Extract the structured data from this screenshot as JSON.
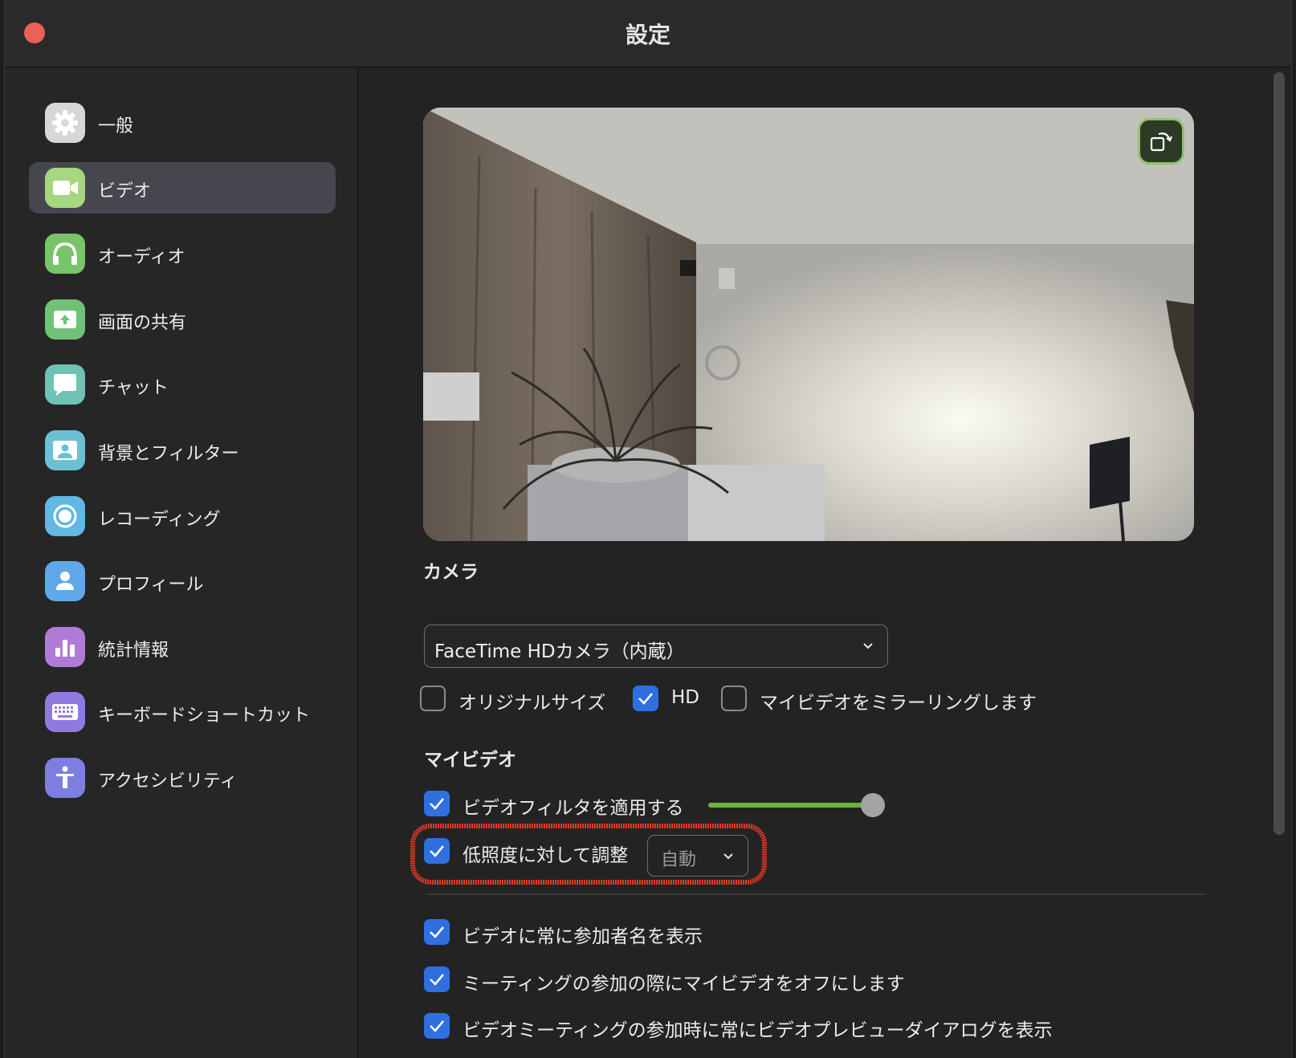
{
  "window": {
    "title": "設定"
  },
  "sidebar": {
    "items": [
      {
        "label": "一般",
        "icon": "gear-icon",
        "color": "#d7d7d7",
        "active": false
      },
      {
        "label": "ビデオ",
        "icon": "video-camera-icon",
        "color": "#a6d67f",
        "active": true
      },
      {
        "label": "オーディオ",
        "icon": "headphones-icon",
        "color": "#79c46a",
        "active": false
      },
      {
        "label": "画面の共有",
        "icon": "share-screen-icon",
        "color": "#71c277",
        "active": false
      },
      {
        "label": "チャット",
        "icon": "chat-bubble-icon",
        "color": "#6ec3b4",
        "active": false
      },
      {
        "label": "背景とフィルター",
        "icon": "background-icon",
        "color": "#6cc0d4",
        "active": false
      },
      {
        "label": "レコーディング",
        "icon": "record-icon",
        "color": "#60b8e3",
        "active": false
      },
      {
        "label": "プロフィール",
        "icon": "profile-icon",
        "color": "#5fa8ea",
        "active": false
      },
      {
        "label": "統計情報",
        "icon": "stats-icon",
        "color": "#b07bd6",
        "active": false
      },
      {
        "label": "キーボードショートカット",
        "icon": "keyboard-icon",
        "color": "#8f7be0",
        "active": false
      },
      {
        "label": "アクセシビリティ",
        "icon": "accessibility-icon",
        "color": "#7c7fe0",
        "active": false
      }
    ]
  },
  "camera": {
    "section_title": "カメラ",
    "selected": "FaceTime HDカメラ（内蔵）",
    "options": [
      {
        "label": "オリジナルサイズ",
        "checked": false
      },
      {
        "label": "HD",
        "checked": true
      },
      {
        "label": "マイビデオをミラーリングします",
        "checked": false
      }
    ]
  },
  "my_video": {
    "section_title": "マイビデオ",
    "filter": {
      "label": "ビデオフィルタを適用する",
      "checked": true,
      "level": 0.94
    },
    "low_light": {
      "label": "低照度に対して調整",
      "checked": true,
      "mode": "自動"
    }
  },
  "other_options": [
    {
      "label": "ビデオに常に参加者名を表示",
      "checked": true
    },
    {
      "label": "ミーティングの参加の際にマイビデオをオフにします",
      "checked": true
    },
    {
      "label": "ビデオミーティングの参加時に常にビデオプレビューダイアログを表示",
      "checked": true
    }
  ],
  "colors": {
    "accent": "#2f6fe0",
    "slider": "#6cb33f",
    "highlight": "#e03a25"
  }
}
